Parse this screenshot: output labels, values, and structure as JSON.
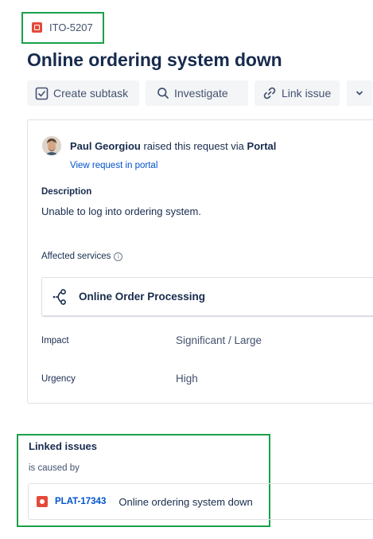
{
  "issue": {
    "key": "ITO-5207",
    "title": "Online ordering system down"
  },
  "toolbar": {
    "create_subtask": "Create subtask",
    "investigate": "Investigate",
    "link_issue": "Link issue"
  },
  "request": {
    "reporter": "Paul Georgiou",
    "raised_via_text": " raised this request via ",
    "channel": "Portal",
    "view_link": "View request in portal"
  },
  "description": {
    "label": "Description",
    "text": "Unable to log into ordering system."
  },
  "affected_services": {
    "label": "Affected services",
    "service": "Online Order Processing"
  },
  "fields": {
    "impact_label": "Impact",
    "impact_value": "Significant / Large",
    "urgency_label": "Urgency",
    "urgency_value": "High"
  },
  "linked_issues": {
    "title": "Linked issues",
    "relation": "is caused by",
    "items": [
      {
        "key": "PLAT-17343",
        "summary": "Online ordering system down"
      }
    ]
  },
  "colors": {
    "highlight": "#1aa04a",
    "link": "#0052cc",
    "issue_type": "#e5493a"
  },
  "icons": [
    "incident-type-icon",
    "subtask-icon",
    "search-icon",
    "link-icon",
    "chevron-down-icon",
    "service-icon",
    "info-icon",
    "bug-type-icon"
  ]
}
